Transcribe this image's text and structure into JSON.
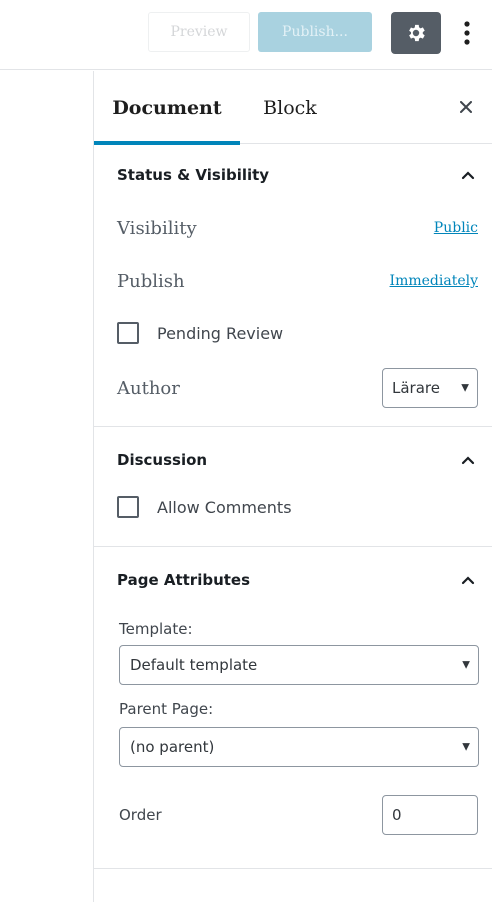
{
  "toolbar": {
    "preview_label": "Preview",
    "publish_label": "Publish...",
    "settings_icon": "gear-icon",
    "more_icon": "vertical-ellipsis-icon"
  },
  "sidebar": {
    "tabs": [
      {
        "label": "Document",
        "active": true
      },
      {
        "label": "Block",
        "active": false
      }
    ],
    "close_icon": "close-icon",
    "status_visibility": {
      "title": "Status & Visibility",
      "visibility_label": "Visibility",
      "visibility_value": "Public",
      "publish_label": "Publish",
      "publish_value": "Immediately",
      "pending_review_label": "Pending Review",
      "pending_review_checked": false,
      "author_label": "Author",
      "author_value": "Lärare"
    },
    "discussion": {
      "title": "Discussion",
      "allow_comments_label": "Allow Comments",
      "allow_comments_checked": false
    },
    "page_attributes": {
      "title": "Page Attributes",
      "template_label": "Template:",
      "template_value": "Default template",
      "parent_label": "Parent Page:",
      "parent_value": "(no parent)",
      "order_label": "Order",
      "order_value": "0"
    }
  },
  "colors": {
    "accent": "#0085ba",
    "settings_bg": "#555d66",
    "publish_bg": "#a9d2e0"
  }
}
